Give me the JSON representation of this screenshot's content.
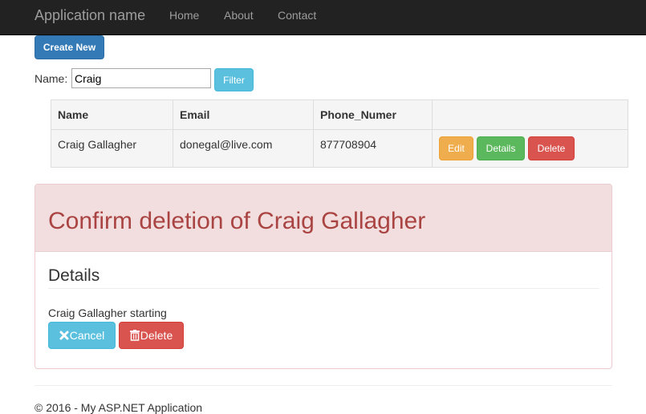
{
  "navbar": {
    "brand": "Application name",
    "links": [
      "Home",
      "About",
      "Contact"
    ]
  },
  "toolbar": {
    "create_label": "Create New"
  },
  "filter": {
    "label": "Name:",
    "value": "Craig",
    "button_label": "Filter"
  },
  "table": {
    "headers": [
      "Name",
      "Email",
      "Phone_Numer",
      ""
    ],
    "rows": [
      {
        "name": "Craig Gallagher",
        "email": "donegal@live.com",
        "phone": "877708904",
        "actions": [
          "Edit",
          "Details",
          "Delete"
        ]
      }
    ]
  },
  "confirm_panel": {
    "title": "Confirm deletion of Craig Gallagher",
    "section_heading": "Details",
    "details_text": "Craig Gallagher starting",
    "cancel_label": "Cancel",
    "delete_label": "Delete"
  },
  "footer": {
    "text": "© 2016 - My ASP.NET Application"
  },
  "colors": {
    "navbar_bg": "#222222",
    "primary": "#337ab7",
    "info": "#5bc0de",
    "warning": "#f0ad4e",
    "success": "#5cb85c",
    "danger": "#d9534f",
    "danger_panel_bg": "#f2dede",
    "danger_text": "#a94442"
  }
}
